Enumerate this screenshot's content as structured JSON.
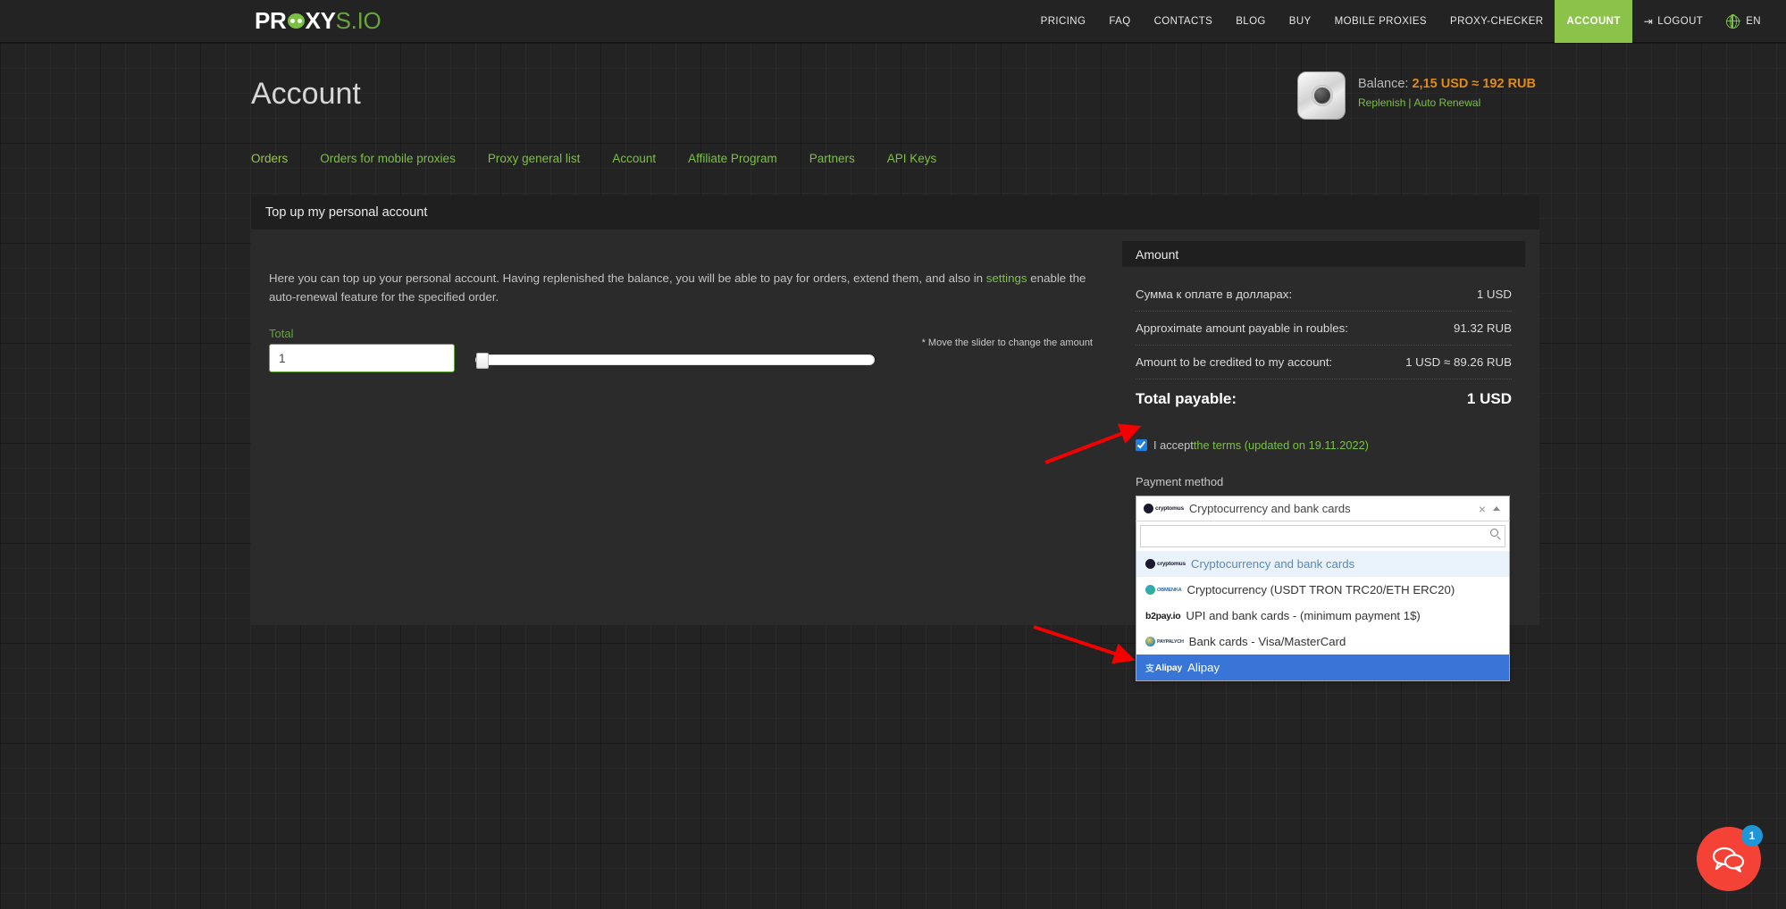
{
  "header": {
    "logo": {
      "part1": "PR",
      "part2": "XY",
      "part3": "S.IO"
    },
    "nav": [
      {
        "label": "PRICING",
        "active": false
      },
      {
        "label": "FAQ",
        "active": false
      },
      {
        "label": "CONTACTS",
        "active": false
      },
      {
        "label": "BLOG",
        "active": false
      },
      {
        "label": "BUY",
        "active": false
      },
      {
        "label": "MOBILE PROXIES",
        "active": false
      },
      {
        "label": "PROXY-CHECKER",
        "active": false
      },
      {
        "label": "ACCOUNT",
        "active": true
      }
    ],
    "logout_label": "LOGOUT",
    "logout_icon": "logout-icon",
    "lang_label": "EN",
    "lang_icon": "globe-icon"
  },
  "page": {
    "title": "Account"
  },
  "balance": {
    "icon": "wallet-icon",
    "label": "Balance:",
    "amount": "2,15 USD ≈ 192 RUB",
    "replenish_label": "Replenish",
    "separator": "|",
    "auto_renewal_label": "Auto Renewal"
  },
  "tabs": [
    {
      "label": "Orders",
      "active": true
    },
    {
      "label": "Orders for mobile proxies",
      "active": false
    },
    {
      "label": "Proxy general list",
      "active": false
    },
    {
      "label": "Account",
      "active": false
    },
    {
      "label": "Affiliate Program",
      "active": false
    },
    {
      "label": "Partners",
      "active": false
    },
    {
      "label": "API Keys",
      "active": false
    }
  ],
  "panel": {
    "title": "Top up my personal account",
    "description_part1": "Here you can top up your personal account. Having replenished the balance, you will be able to pay for orders, extend them, and also in ",
    "description_link": "settings",
    "description_part2": " enable the auto-renewal feature for the specified order.",
    "total_label": "Total",
    "total_value": "1",
    "total_placeholder": "1",
    "slider_hint": "* Move the slider to change the amount",
    "slider_value": 1,
    "slider_min": 1,
    "slider_max": 1000
  },
  "amount": {
    "title": "Amount",
    "rows": [
      {
        "label": "Сумма к оплате в долларах:",
        "value": "1 USD"
      },
      {
        "label": "Approximate amount payable in roubles:",
        "value": "91.32 RUB"
      },
      {
        "label": "Amount to be credited to my account:",
        "value": "1 USD ≈ 89.26 RUB"
      }
    ],
    "total_label": "Total payable:",
    "total_value": "1 USD",
    "terms_prefix": "I accept ",
    "terms_link": "the terms (updated on 19.11.2022)",
    "terms_checked": true,
    "payment_method_label": "Payment method"
  },
  "payment_select": {
    "selected_label": "Cryptocurrency and bank cards",
    "selected_logo": "cryptomus",
    "clear_icon": "close-icon",
    "arrow_icon": "chevron-up-icon",
    "search_value": "",
    "search_placeholder": "",
    "search_icon": "search-icon",
    "options": [
      {
        "logo": "cryptomus",
        "logo_text": "cryptomus",
        "label": "Cryptocurrency and bank cards",
        "state": "selected"
      },
      {
        "logo": "obmenka",
        "logo_text": "OBMENKA",
        "label": "Cryptocurrency (USDT TRON TRC20/ETH ERC20)",
        "state": "normal"
      },
      {
        "logo": "b2pay",
        "logo_text": "b2pay.io",
        "label": "UPI and bank cards - (minimum payment 1$)",
        "state": "normal"
      },
      {
        "logo": "paypalych",
        "logo_text": "PAYPALYCH",
        "label": "Bank cards - Visa/MasterCard",
        "state": "normal"
      },
      {
        "logo": "alipay",
        "logo_text": "Alipay",
        "label": "Alipay",
        "state": "highlight"
      }
    ]
  },
  "chat": {
    "icon": "chat-bubbles-icon",
    "badge": "1"
  },
  "colors": {
    "accent_green": "#7ac143",
    "nav_active": "#8bc34a",
    "balance_orange": "#e08b18",
    "highlight_blue": "#3875d7",
    "chat_red": "#f44336",
    "badge_blue": "#2196d6",
    "arrow_red": "#f40000"
  }
}
